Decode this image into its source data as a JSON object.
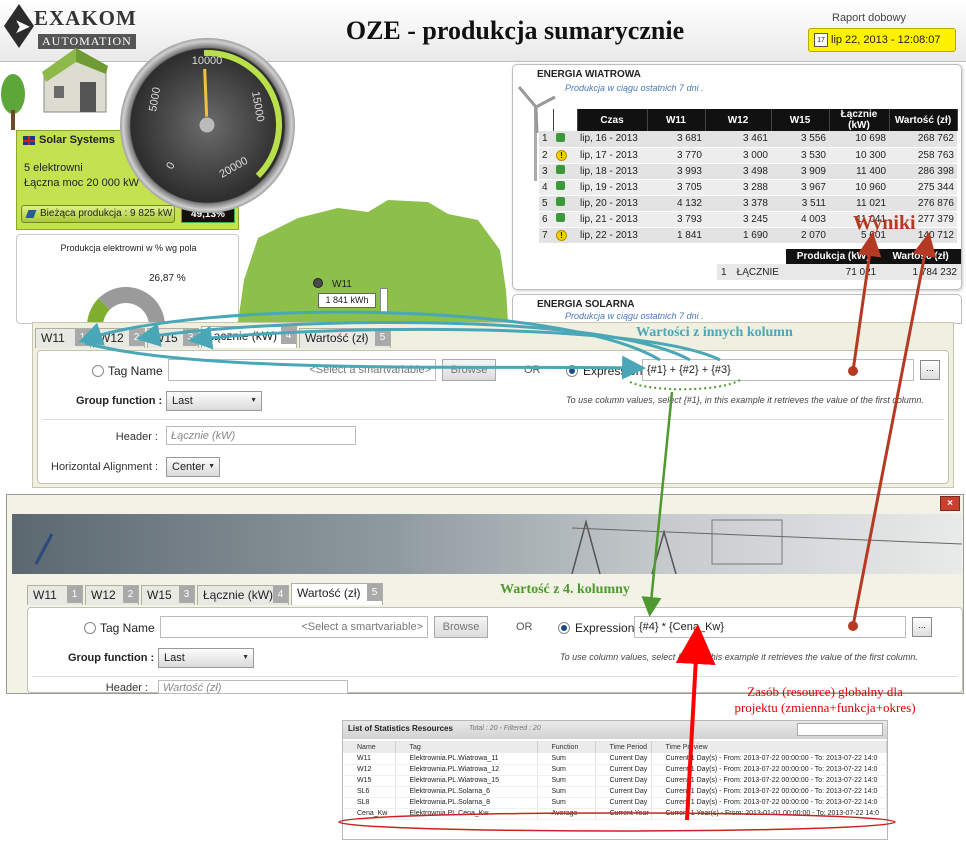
{
  "dashboard": {
    "title": "OZE - produkcja sumarycznie",
    "logo_name": "EXAKOM",
    "logo_sub": "AUTOMATION",
    "report_caption": "Raport dobowy",
    "report_date": "lip 22, 2013 - 12:08:07"
  },
  "solar": {
    "name": "Solar Systems",
    "plants": "5  elektrowni",
    "power": "Łączna moc  20 000 kW",
    "production": "Bieżąca produkcja : 9 825 kW",
    "percent": "49,13%"
  },
  "gauge": {
    "ticks": [
      "0",
      "5000",
      "10000",
      "15000",
      "20000"
    ],
    "value": 9825,
    "max": 20000
  },
  "pie": {
    "title": "Produkcja elektrowni w % wg pola",
    "label": "26,87 %"
  },
  "map": {
    "marker_label": "W11",
    "marker_value": "1 841 kWh"
  },
  "wind": {
    "title": "ENERGIA WIATROWA",
    "subtitle": "Produkcja w ciągu ostatnich 7 dni .",
    "columns": [
      "",
      "",
      "Czas",
      "W11",
      "W12",
      "W15",
      "Łącznie (kW)",
      "Wartość (zł)"
    ],
    "rows": [
      [
        "1",
        "ok",
        "lip, 16 - 2013",
        "3 681",
        "3 461",
        "3 556",
        "10 698",
        "268 762"
      ],
      [
        "2",
        "warn",
        "lip, 17 - 2013",
        "3 770",
        "3 000",
        "3 530",
        "10 300",
        "258 763"
      ],
      [
        "3",
        "ok",
        "lip, 18 - 2013",
        "3 993",
        "3 498",
        "3 909",
        "11 400",
        "286 398"
      ],
      [
        "4",
        "ok",
        "lip, 19 - 2013",
        "3 705",
        "3 288",
        "3 967",
        "10 960",
        "275 344"
      ],
      [
        "5",
        "ok",
        "lip, 20 - 2013",
        "4 132",
        "3 378",
        "3 511",
        "11 021",
        "276 876"
      ],
      [
        "6",
        "ok",
        "lip, 21 - 2013",
        "3 793",
        "3 245",
        "4 003",
        "11 041",
        "277 379"
      ],
      [
        "7",
        "warn",
        "lip, 22 - 2013",
        "1 841",
        "1 690",
        "2 070",
        "5 601",
        "140 712"
      ]
    ],
    "total_columns": [
      "",
      "",
      "Produkcja (kW)",
      "Wartość (zł)"
    ],
    "total_row": [
      "1",
      "ŁĄCZNIE",
      "71 021",
      "1 784 232"
    ]
  },
  "solar_card": {
    "title": "ENERGIA SOLARNA",
    "subtitle": "Produkcja w ciągu ostatnich 7 dni ."
  },
  "editor1": {
    "tabs": [
      {
        "label": "W11",
        "num": "1"
      },
      {
        "label": "W12",
        "num": "2"
      },
      {
        "label": "W15",
        "num": "3"
      },
      {
        "label": "Łącznie (kW)",
        "num": "4"
      },
      {
        "label": "Wartość (zł)",
        "num": "5"
      }
    ],
    "tag_name_label": "Tag Name",
    "tag_placeholder": "<Select a smartvariable>",
    "browse": "Browse",
    "or": "OR",
    "expression_label": "Expression",
    "expression_value": "{#1} + {#2} + {#3}",
    "dots": "...",
    "group_label": "Group function :",
    "group_value": "Last",
    "hint": "To use column values, select {#1}, in this example it retrieves the value of the first column.",
    "header_label": "Header :",
    "header_value": "Łącznie (kW)",
    "align_label": "Horizontal Alignment :",
    "align_value": "Center"
  },
  "editor2": {
    "close": "×",
    "tabs": [
      {
        "label": "W11",
        "num": "1"
      },
      {
        "label": "W12",
        "num": "2"
      },
      {
        "label": "W15",
        "num": "3"
      },
      {
        "label": "Łącznie (kW)",
        "num": "4"
      },
      {
        "label": "Wartość (zł)",
        "num": "5"
      }
    ],
    "tag_name_label": "Tag Name",
    "tag_placeholder": "<Select a smartvariable>",
    "browse": "Browse",
    "or": "OR",
    "expression_label": "Expression",
    "expression_value": "{#4} * {Cena_Kw}",
    "dots": "...",
    "group_label": "Group function :",
    "group_value": "Last",
    "hint": "To use column values, select {#1}, in this example it retrieves the value of the first column.",
    "header_label": "Header :",
    "header_value": "Wartość (zł)"
  },
  "resources": {
    "title": "List of Statistics Resources",
    "total": "Total : 20 - Filtered : 20",
    "columns": [
      "Name",
      "Tag",
      "Function",
      "Time Period",
      "Time Preview"
    ],
    "rows": [
      [
        "W11",
        "Elektrownia.PL.Wiatrowa_11",
        "Sum",
        "Current Day",
        "Current 1 Day(s) - From: 2013-07-22 00:00:00 - To: 2013-07-22 14:0"
      ],
      [
        "W12",
        "Elektrownia.PL.Wiatrowa_12",
        "Sum",
        "Current Day",
        "Current 1 Day(s) - From: 2013-07-22 00:00:00 - To: 2013-07-22 14:0"
      ],
      [
        "W15",
        "Elektrownia.PL.Wiatrowa_15",
        "Sum",
        "Current Day",
        "Current 1 Day(s) - From: 2013-07-22 00:00:00 - To: 2013-07-22 14:0"
      ],
      [
        "SL6",
        "Elektrownia.PL.Solarna_6",
        "Sum",
        "Current Day",
        "Current 1 Day(s) - From: 2013-07-22 00:00:00 - To: 2013-07-22 14:0"
      ],
      [
        "SL8",
        "Elektrownia.PL.Solarna_8",
        "Sum",
        "Current Day",
        "Current 1 Day(s) - From: 2013-07-22 00:00:00 - To: 2013-07-22 14:0"
      ],
      [
        "Cena_Kw",
        "Elektrownia.PL.Cena_Kw",
        "Average",
        "Current Year",
        "Current 1 Year(s) - From: 2013-01-01 00:00:00 - To: 2013-07-22 14:0"
      ]
    ]
  },
  "annotations": {
    "other_columns": "Wartości z innych kolumn",
    "fourth_column": "Wartość z 4. kolumny",
    "results": "Wyniki",
    "resource_line1": "Zasób (resource) globalny dla",
    "resource_line2": "projektu (zmienna+funkcja+okres)"
  },
  "colors": {
    "accent_green": "#c4e24f",
    "date_yellow": "#fff200",
    "arrow_blue": "#4aa7b7",
    "arrow_green": "#4e9a2e",
    "arrow_red": "#b53a24"
  }
}
